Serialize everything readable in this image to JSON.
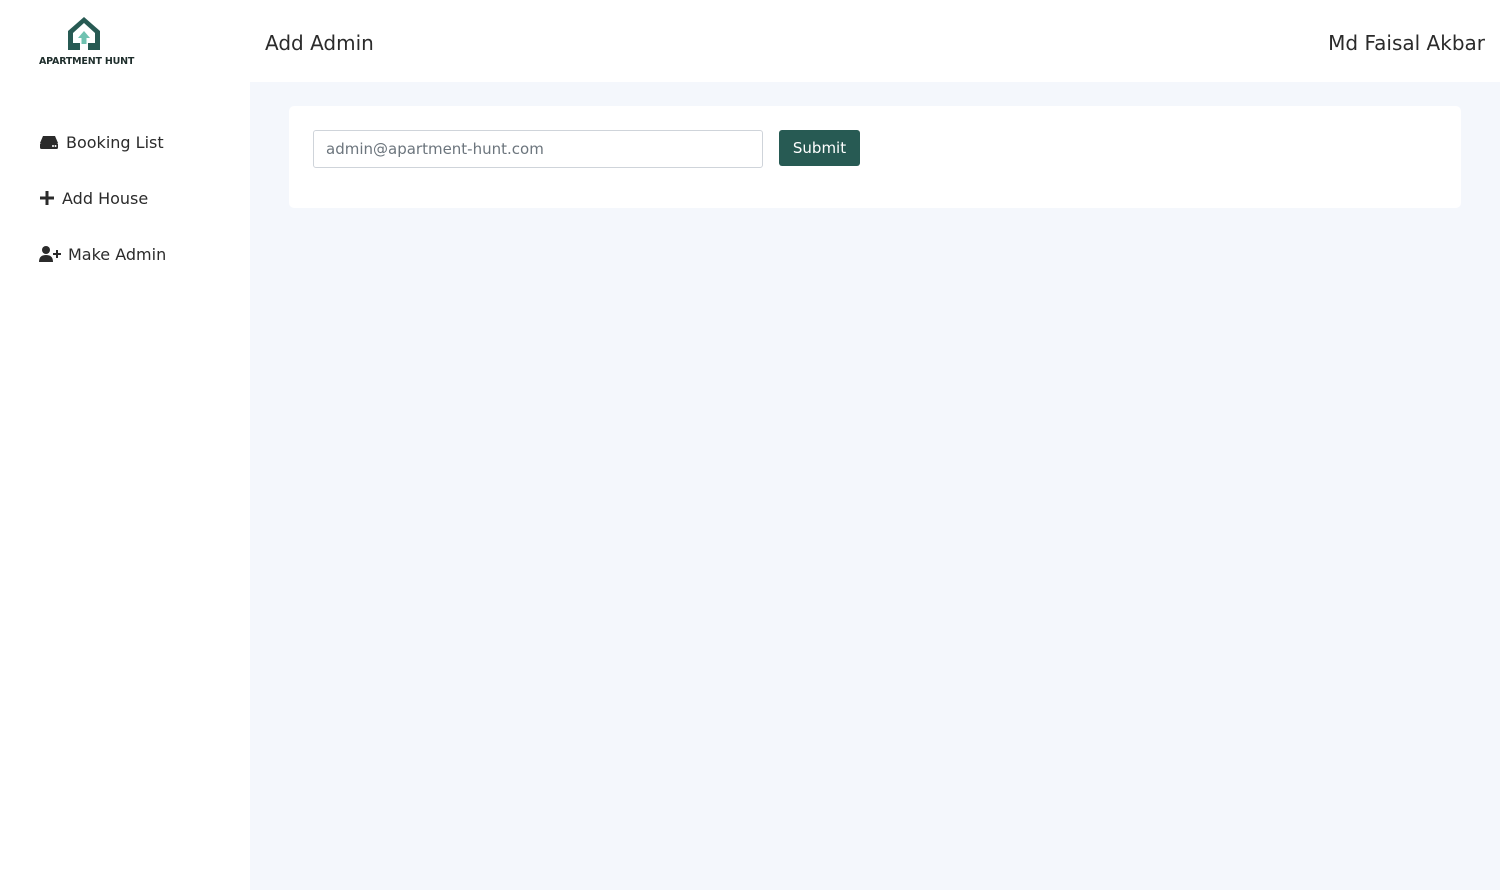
{
  "brand": {
    "name": "APARTMENT HUNT",
    "logo_icon": "house-icon",
    "color": "#275a53",
    "accent": "#6fc2b0"
  },
  "header": {
    "title": "Add Admin",
    "user_name": "Md Faisal Akbar"
  },
  "sidebar": {
    "items": [
      {
        "label": "Booking List",
        "icon": "hdd-icon"
      },
      {
        "label": "Add House",
        "icon": "plus-icon"
      },
      {
        "label": "Make Admin",
        "icon": "user-plus-icon"
      }
    ]
  },
  "form": {
    "email_placeholder": "admin@apartment-hunt.com",
    "submit_label": "Submit"
  },
  "colors": {
    "primary": "#275a53",
    "main_background": "#f4f7fc",
    "card_background": "#ffffff"
  }
}
